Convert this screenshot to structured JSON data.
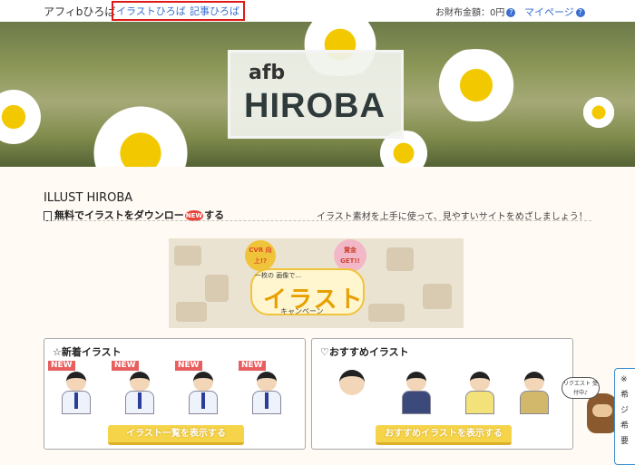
{
  "header": {
    "brand": "アフィbひろば",
    "nav": [
      {
        "label": "イラストひろば"
      },
      {
        "label": "記事ひろば"
      }
    ],
    "wallet_label": "お財布金額：0円",
    "mypage_label": "マイページ"
  },
  "hero": {
    "logo_small": "afb",
    "logo_main": "HIROBA"
  },
  "main": {
    "section_title": "ILLUST HIROBA",
    "subtitle_left": "無料でイラストをダウンロー",
    "subtitle_left_tail": "する",
    "new_badge": "NEW",
    "subtitle_right": "イラスト素材を上手に使って、見やすいサイトをめざしましょう！"
  },
  "banner": {
    "badge1": "CVR 向上!?",
    "badge2": "賞金 GET!!",
    "small": "一枚の 画像で…",
    "main": "イラスト",
    "sub": "キャンペーン"
  },
  "new_illust": {
    "title": "☆新着イラスト",
    "tag": "NEW",
    "button": "イラスト一覧を表示する"
  },
  "recommended": {
    "title": "♡おすすめイラスト",
    "button": "おすすめイラストを表示する"
  },
  "mascot": {
    "bubble": "リクエスト 受付中♪"
  },
  "side_tab": {
    "lines": [
      "※",
      "希",
      "ジ",
      "希",
      "要"
    ]
  }
}
